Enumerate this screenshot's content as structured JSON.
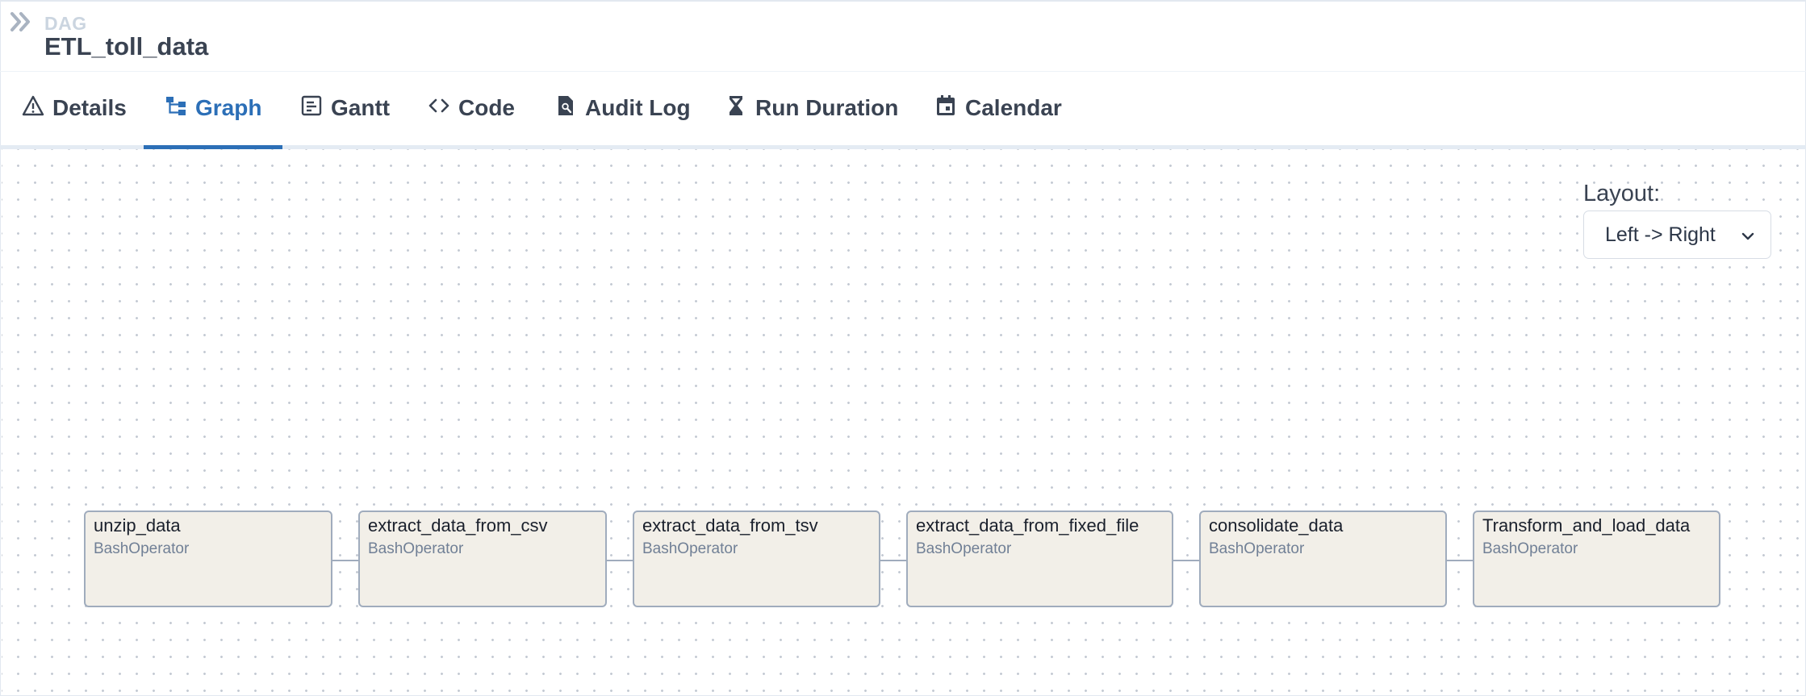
{
  "header": {
    "label": "DAG",
    "title": "ETL_toll_data",
    "collapse_icon": "chevron-double-right-icon"
  },
  "tabs": [
    {
      "label": "Details",
      "icon": "warning-triangle-icon",
      "active": false
    },
    {
      "label": "Graph",
      "icon": "graph-tree-icon",
      "active": true
    },
    {
      "label": "Gantt",
      "icon": "gantt-doc-icon",
      "active": false
    },
    {
      "label": "Code",
      "icon": "code-brackets-icon",
      "active": false
    },
    {
      "label": "Audit Log",
      "icon": "audit-search-doc-icon",
      "active": false
    },
    {
      "label": "Run Duration",
      "icon": "hourglass-icon",
      "active": false
    },
    {
      "label": "Calendar",
      "icon": "calendar-icon",
      "active": false
    }
  ],
  "layout": {
    "label": "Layout:",
    "selected": "Left -> Right"
  },
  "graph": {
    "nodes": [
      {
        "task_id": "unzip_data",
        "operator": "BashOperator"
      },
      {
        "task_id": "extract_data_from_csv",
        "operator": "BashOperator"
      },
      {
        "task_id": "extract_data_from_tsv",
        "operator": "BashOperator"
      },
      {
        "task_id": "extract_data_from_fixed_file",
        "operator": "BashOperator"
      },
      {
        "task_id": "consolidate_data",
        "operator": "BashOperator"
      },
      {
        "task_id": "Transform_and_load_data",
        "operator": "BashOperator"
      }
    ]
  },
  "colors": {
    "accent": "#2c6fb7",
    "node_fill": "#f2efe8",
    "node_border": "#a0acbd",
    "text": "#3a4352",
    "muted": "#cbd5e0"
  }
}
